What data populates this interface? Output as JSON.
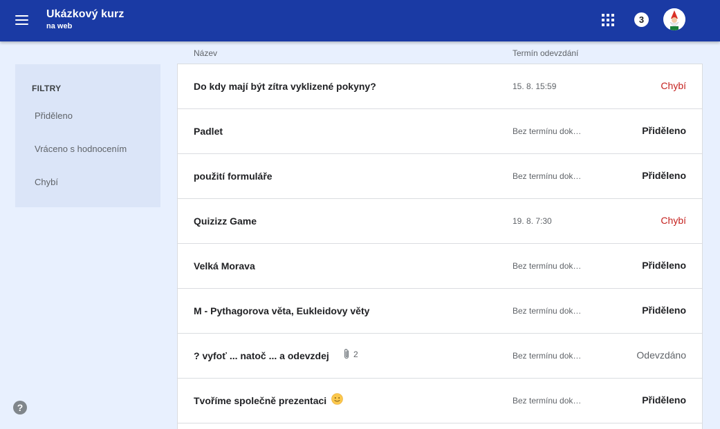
{
  "header": {
    "course_title": "Ukázkový kurz",
    "course_subtitle": "na web",
    "notification_count": "3"
  },
  "sidebar": {
    "heading": "FILTRY",
    "items": [
      {
        "label": "Přiděleno"
      },
      {
        "label": "Vráceno s hodnocením"
      },
      {
        "label": "Chybí"
      }
    ],
    "help_label": "?"
  },
  "columns": {
    "name": "Název",
    "due": "Termín odevzdání"
  },
  "assignments": [
    {
      "title": "Do kdy mají být zítra vyklizené pokyny?",
      "due": "15. 8. 15:59",
      "status": "Chybí",
      "status_type": "missing"
    },
    {
      "title": "Padlet",
      "due": "Bez termínu dok…",
      "status": "Přiděleno",
      "status_type": "assigned"
    },
    {
      "title": "použití formuláře",
      "due": "Bez termínu dok…",
      "status": "Přiděleno",
      "status_type": "assigned"
    },
    {
      "title": "Quizizz Game",
      "due": "19. 8. 7:30",
      "status": "Chybí",
      "status_type": "missing"
    },
    {
      "title": "Velká Morava",
      "due": "Bez termínu dok…",
      "status": "Přiděleno",
      "status_type": "assigned"
    },
    {
      "title": "M - Pythagorova věta, Eukleidovy věty",
      "due": "Bez termínu dok…",
      "status": "Přiděleno",
      "status_type": "assigned"
    },
    {
      "title": "? vyfoť ... natoč ... a odevzdej",
      "due": "Bez termínu dok…",
      "status": "Odevzdáno",
      "status_type": "turnedin",
      "attachments": "2"
    },
    {
      "title": "Tvoříme společně prezentaci",
      "due": "Bez termínu dok…",
      "status": "Přiděleno",
      "status_type": "assigned",
      "emoji": "smiley-icon"
    }
  ],
  "colors": {
    "appbar": "#1a3aa4",
    "missing": "#c5221f",
    "background": "#e8f0fe"
  }
}
